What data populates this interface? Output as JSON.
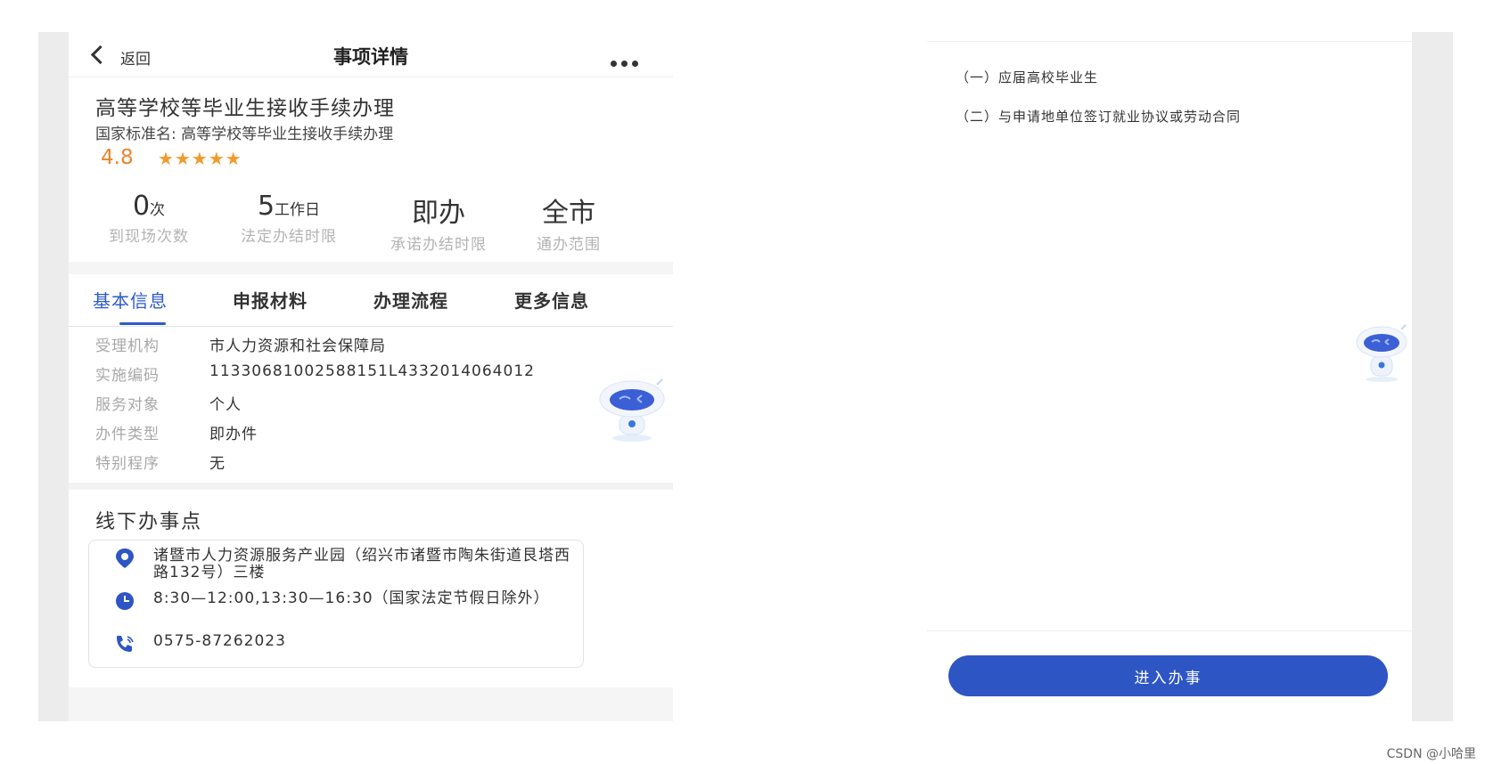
{
  "left": {
    "nav": {
      "back_label": "返回",
      "title": "事项详情"
    },
    "service": {
      "title": "高等学校等毕业生接收手续办理",
      "standard_name": "国家标准名: 高等学校等毕业生接收手续办理",
      "rating": "4.8",
      "stars": 5
    },
    "stats": [
      {
        "value": "0",
        "unit": "次",
        "label": "到现场次数"
      },
      {
        "value": "5",
        "unit": "工作日",
        "label": "法定办结时限"
      },
      {
        "value": "即办",
        "unit": "",
        "label": "承诺办结时限"
      },
      {
        "value": "全市",
        "unit": "",
        "label": "通办范围"
      }
    ],
    "tabs": [
      "基本信息",
      "申报材料",
      "办理流程",
      "更多信息"
    ],
    "active_tab": "基本信息",
    "info": [
      {
        "label": "受理机构",
        "value": "市人力资源和社会保障局"
      },
      {
        "label": "实施编码",
        "value": "11330681002588151L4332014064012"
      },
      {
        "label": "服务对象",
        "value": "个人"
      },
      {
        "label": "办件类型",
        "value": "即办件"
      },
      {
        "label": "特别程序",
        "value": "无"
      }
    ],
    "offline": {
      "title": "线下办事点",
      "address": "诸暨市人力资源服务产业园（绍兴市诸暨市陶朱街道艮塔西路132号）三楼",
      "hours": "8:30—12:00,13:30—16:30（国家法定节假日除外）",
      "phone": "0575-87262023"
    }
  },
  "right": {
    "requirements": [
      "（一）应届高校毕业生",
      "（二）与申请地单位签订就业协议或劳动合同"
    ],
    "enter_button": "进入办事"
  },
  "watermark": "CSDN @小哈里",
  "colors": {
    "primary": "#2e55c4",
    "rating": "#e8862c",
    "muted": "#a8a8a8"
  }
}
